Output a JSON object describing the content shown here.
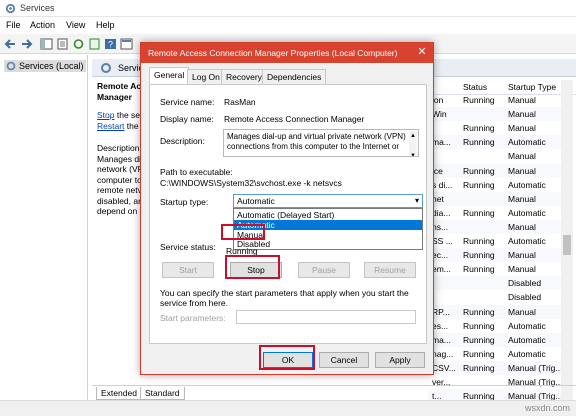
{
  "window": {
    "title": "Services"
  },
  "menu": [
    "File",
    "Action",
    "View",
    "Help"
  ],
  "tree": {
    "root": "Services (Local)"
  },
  "main_header": {
    "label": "Servic"
  },
  "description_pane": {
    "title_1": "Remote Ac",
    "title_2": "Manager",
    "stop_link": "Stop",
    "stop_rest": " the ser",
    "restart_link": "Restart",
    "restart_rest": " the s",
    "desc_lines": [
      "Description:",
      "Manages di",
      "network (VP",
      "computer to",
      "remote netv",
      "disabled, an",
      "depend on i"
    ]
  },
  "table": {
    "headers": [
      "Status",
      "Startup Type"
    ],
    "rows": [
      {
        "name": "ion",
        "status": "Running",
        "startup": "Manual"
      },
      {
        "name": "Win",
        "status": "",
        "startup": "Manual"
      },
      {
        "name": "",
        "status": "Running",
        "startup": "Manual"
      },
      {
        "name": "ma...",
        "status": "Running",
        "startup": "Automatic"
      },
      {
        "name": "",
        "status": "",
        "startup": "Manual"
      },
      {
        "name": "ice",
        "status": "Running",
        "startup": "Manual"
      },
      {
        "name": "s di...",
        "status": "Running",
        "startup": "Automatic"
      },
      {
        "name": "net",
        "status": "",
        "startup": "Manual"
      },
      {
        "name": "dia...",
        "status": "Running",
        "startup": "Automatic"
      },
      {
        "name": "ns...",
        "status": "",
        "startup": "Manual"
      },
      {
        "name": "SS ...",
        "status": "Running",
        "startup": "Automatic"
      },
      {
        "name": "ec...",
        "status": "Running",
        "startup": "Manual"
      },
      {
        "name": "em...",
        "status": "Running",
        "startup": "Manual"
      },
      {
        "name": "",
        "status": "",
        "startup": "Disabled"
      },
      {
        "name": "",
        "status": "",
        "startup": "Disabled"
      },
      {
        "name": "RP...",
        "status": "Running",
        "startup": "Manual"
      },
      {
        "name": "es...",
        "status": "Running",
        "startup": "Automatic"
      },
      {
        "name": "ma...",
        "status": "Running",
        "startup": "Automatic"
      },
      {
        "name": "nag...",
        "status": "Running",
        "startup": "Automatic"
      },
      {
        "name": "CSV...",
        "status": "Running",
        "startup": "Manual (Trig..."
      },
      {
        "name": "ver...",
        "status": "",
        "startup": "Manual (Trig..."
      },
      {
        "name": "t...",
        "status": "Running",
        "startup": "Manual (Trig..."
      }
    ]
  },
  "bottom_tabs": [
    "Extended",
    "Standard"
  ],
  "watermark": "wsxdn.com",
  "dialog": {
    "title": "Remote Access Connection Manager Properties (Local Computer)",
    "tabs": [
      "General",
      "Log On",
      "Recovery",
      "Dependencies"
    ],
    "service_name_label": "Service name:",
    "service_name": "RasMan",
    "display_name_label": "Display name:",
    "display_name": "Remote Access Connection Manager",
    "description_label": "Description:",
    "description_text": "Manages dial-up and virtual private network (VPN) connections from this computer to the Internet or",
    "path_label": "Path to executable:",
    "path_value": "C:\\WINDOWS\\System32\\svchost.exe -k netsvcs",
    "startup_type_label": "Startup type:",
    "startup_selected": "Automatic",
    "startup_options": [
      "Automatic (Delayed Start)",
      "Automatic",
      "Manual",
      "Disabled"
    ],
    "service_status_label": "Service status:",
    "service_status_value": "Running",
    "buttons": {
      "start": "Start",
      "stop": "Stop",
      "pause": "Pause",
      "resume": "Resume"
    },
    "params_help": "You can specify the start parameters that apply when you start the service from here.",
    "start_params_label": "Start parameters:",
    "ok": "OK",
    "cancel": "Cancel",
    "apply": "Apply"
  },
  "colors": {
    "dialog_title": "#d8432f",
    "highlight": "#c8102e",
    "selection": "#0078d7"
  }
}
